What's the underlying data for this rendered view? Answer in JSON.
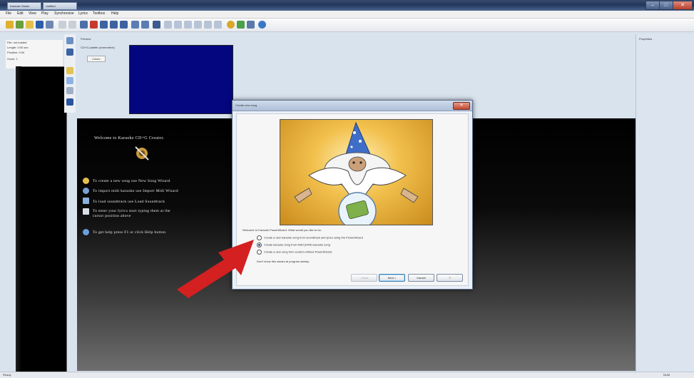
{
  "window": {
    "title_tab_1": "Karaoke Studio",
    "title_tab_2": "Untitled",
    "minimize": "–",
    "maximize": "□",
    "close": "✕"
  },
  "menu": [
    "File",
    "Edit",
    "View",
    "Play",
    "Synchronize",
    "Lyrics",
    "Toolbox",
    "Help"
  ],
  "left_info": {
    "line1": "File:   not loaded",
    "line2": "Length:   0:00 sec",
    "line3": "Position:  0:00",
    "line4": "Zoom:    1"
  },
  "preview": {
    "title": "Preview",
    "option": "CD+G palette (screen/text)",
    "button": "Colors"
  },
  "right_panel": {
    "title": "Properties"
  },
  "welcome": {
    "title": "Welcome to Karaoke CD+G Creator.",
    "items": [
      "To create a new song use New Song Wizard",
      "To import midi karaoke use Import Midi Wizard",
      "To load soundtrack use Load Soundtrack",
      "To enter your lyrics start typing them at the",
      "cursor position above",
      "To get help press F1 or click Help button"
    ]
  },
  "dialog": {
    "title": "Create new song",
    "close": "✕",
    "question": "Welcome to Karaoke PowerWizard. What would you like to do:",
    "options": [
      "Create a new karaoke song from soundtrack and lyrics using the PowerWizard",
      "Create karaoke song from MIDI (KAR) karaoke song",
      "Create a new song from scratch without PowerWizard"
    ],
    "selected_index": 1,
    "hint": "Don't show this wizard at program startup",
    "buttons": {
      "back": "< Back",
      "next": "Next >",
      "cancel": "Cancel",
      "help": "?"
    }
  },
  "status": {
    "left": "Ready",
    "right": "NUM"
  },
  "colors": {
    "preview_blue": "#03067f",
    "arrow_red": "#d42020",
    "titlebar": "#22355a"
  }
}
